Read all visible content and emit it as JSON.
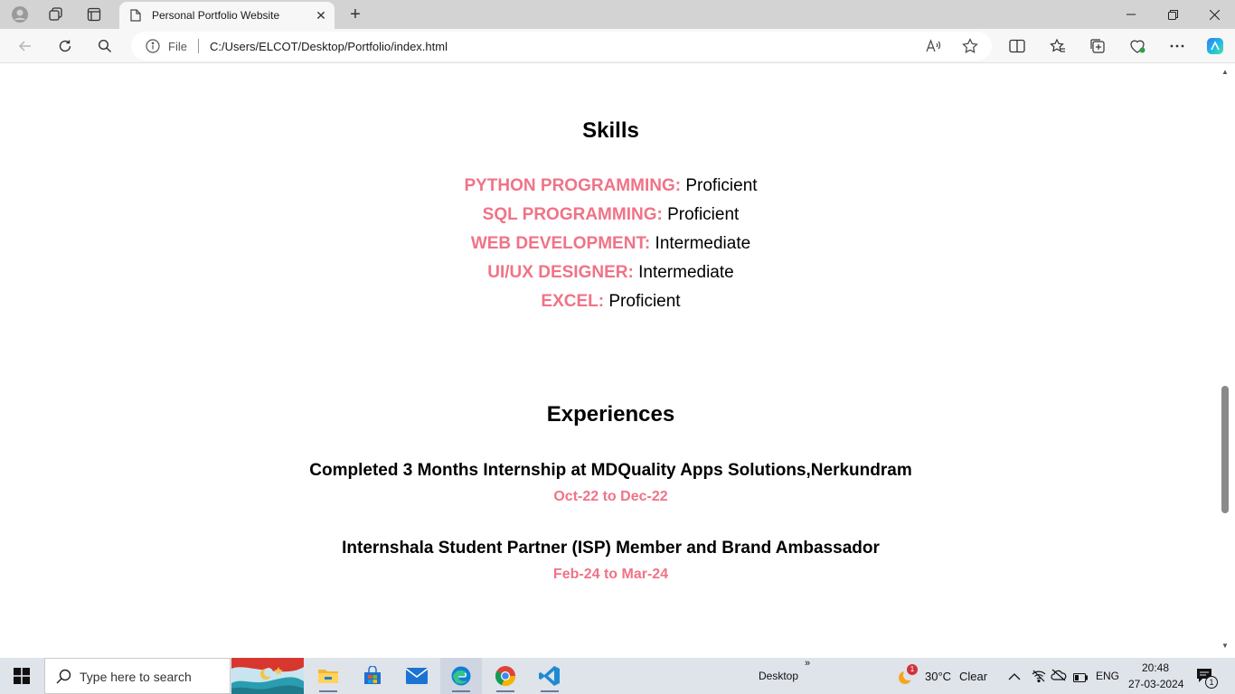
{
  "browser": {
    "tab_title": "Personal Portfolio Website",
    "address_label": "File",
    "url": "C:/Users/ELCOT/Desktop/Portfolio/index.html"
  },
  "skills": {
    "title": "Skills",
    "items": [
      {
        "name": "PYTHON PROGRAMMING:",
        "level": "Proficient"
      },
      {
        "name": "SQL PROGRAMMING:",
        "level": "Proficient"
      },
      {
        "name": "WEB DEVELOPMENT:",
        "level": "Intermediate"
      },
      {
        "name": "UI/UX DESIGNER:",
        "level": "Intermediate"
      },
      {
        "name": "EXCEL:",
        "level": "Proficient"
      }
    ]
  },
  "experiences": {
    "title": "Experiences",
    "items": [
      {
        "title": "Completed 3 Months Internship at MDQuality Apps Solutions,Nerkundram",
        "date": "Oct-22 to Dec-22"
      },
      {
        "title": "Internshala Student Partner (ISP) Member and Brand Ambassador",
        "date": "Feb-24 to Mar-24"
      }
    ]
  },
  "taskbar": {
    "search_placeholder": "Type here to search",
    "desktop_label": "Desktop",
    "weather_temp": "30°C",
    "weather_desc": "Clear",
    "weather_badge": "1",
    "language": "ENG",
    "time": "20:48",
    "date": "27-03-2024",
    "notification_count": "1"
  },
  "colors": {
    "accent_pink": "#f07387",
    "tab_bar": "#d3d3d3",
    "taskbar": "#dfe3ea"
  }
}
